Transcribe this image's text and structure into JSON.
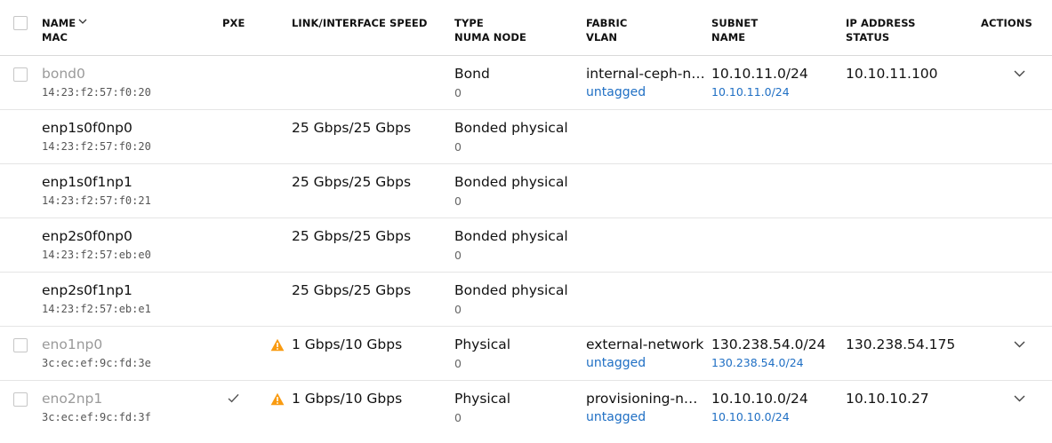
{
  "header": {
    "name": "NAME",
    "mac": "MAC",
    "pxe": "PXE",
    "speed": "LINK/INTERFACE SPEED",
    "type": "TYPE",
    "numa": "NUMA NODE",
    "fabric": "FABRIC",
    "vlan": "VLAN",
    "subnet": "SUBNET",
    "subnet_name": "NAME",
    "ip": "IP ADDRESS",
    "status": "STATUS",
    "actions": "ACTIONS"
  },
  "rows": [
    {
      "name": "bond0",
      "mac": "14:23:f2:57:f0:20",
      "speed": "",
      "type": "Bond",
      "numa": "0",
      "fabric": "internal-ceph-n…",
      "vlan": "untagged",
      "subnet": "10.10.11.0/24",
      "subnet_name": "10.10.11.0/24",
      "ip": "10.10.11.100"
    },
    {
      "name": "enp1s0f0np0",
      "mac": "14:23:f2:57:f0:20",
      "speed": "25 Gbps/25 Gbps",
      "type": "Bonded physical",
      "numa": "0"
    },
    {
      "name": "enp1s0f1np1",
      "mac": "14:23:f2:57:f0:21",
      "speed": "25 Gbps/25 Gbps",
      "type": "Bonded physical",
      "numa": "0"
    },
    {
      "name": "enp2s0f0np0",
      "mac": "14:23:f2:57:eb:e0",
      "speed": "25 Gbps/25 Gbps",
      "type": "Bonded physical",
      "numa": "0"
    },
    {
      "name": "enp2s0f1np1",
      "mac": "14:23:f2:57:eb:e1",
      "speed": "25 Gbps/25 Gbps",
      "type": "Bonded physical",
      "numa": "0"
    },
    {
      "name": "eno1np0",
      "mac": "3c:ec:ef:9c:fd:3e",
      "speed": "1 Gbps/10 Gbps",
      "type": "Physical",
      "numa": "0",
      "fabric": "external-network",
      "vlan": "untagged",
      "subnet": "130.238.54.0/24",
      "subnet_name": "130.238.54.0/24",
      "ip": "130.238.54.175"
    },
    {
      "name": "eno2np1",
      "mac": "3c:ec:ef:9c:fd:3f",
      "speed": "1 Gbps/10 Gbps",
      "type": "Physical",
      "numa": "0",
      "fabric": "provisioning-n…",
      "vlan": "untagged",
      "subnet": "10.10.10.0/24",
      "subnet_name": "10.10.10.0/24",
      "ip": "10.10.10.27"
    }
  ],
  "icons": {
    "sort": "chevron-down-icon",
    "warning": "warning-icon",
    "pxe_check": "check-icon",
    "expand": "chevron-down-icon"
  },
  "colors": {
    "warning": "#f99b11",
    "link": "#1f6fc4",
    "muted_text": "#9a9a9a"
  }
}
